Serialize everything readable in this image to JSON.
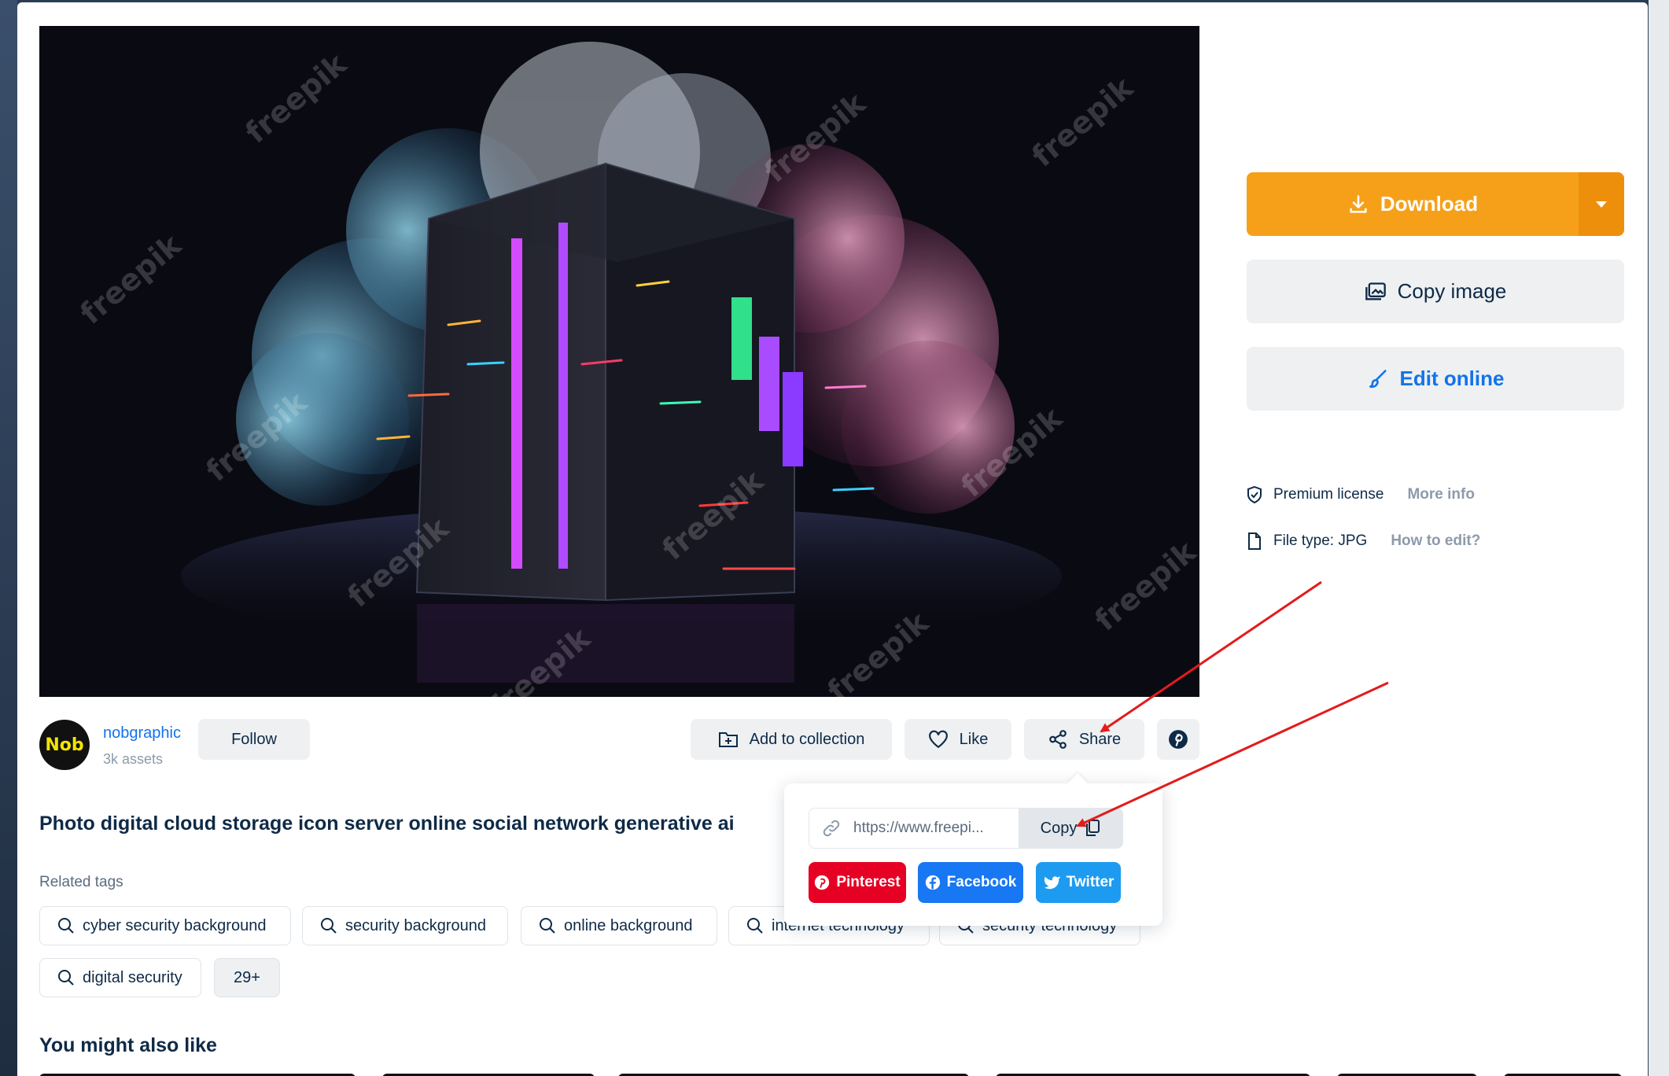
{
  "image": {
    "watermark": "freepik"
  },
  "actions": {
    "download_label": "Download",
    "copy_image_label": "Copy image",
    "edit_online_label": "Edit online"
  },
  "license": {
    "license_label": "Premium license",
    "license_link": "More info",
    "file_type_label": "File type: JPG",
    "file_type_link": "How to edit?"
  },
  "author": {
    "avatar_text": "Nob",
    "name": "nobgraphic",
    "assets": "3k assets",
    "follow_label": "Follow"
  },
  "toolbar": {
    "add_collection_label": "Add to collection",
    "like_label": "Like",
    "share_label": "Share"
  },
  "share_popover": {
    "url": "https://www.freepi...",
    "copy_label": "Copy",
    "pinterest_label": "Pinterest",
    "facebook_label": "Facebook",
    "twitter_label": "Twitter"
  },
  "title": "Photo digital cloud storage icon server online social network generative ai",
  "related": {
    "label": "Related tags",
    "tags": [
      "cyber security background",
      "security background",
      "online background",
      "internet technology",
      "security technology",
      "digital security"
    ],
    "more_label": "29+"
  },
  "also_like": "You might also like",
  "colors": {
    "download": "#f6a01a",
    "link_blue": "#1273eb",
    "pinterest": "#e60023",
    "facebook": "#1877f2",
    "twitter": "#1d9bf0",
    "annotation_arrow": "#e31b1b"
  }
}
